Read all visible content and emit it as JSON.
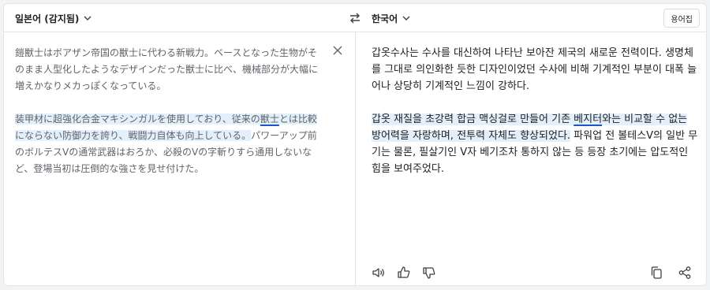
{
  "header": {
    "source_language": "일본어 (감지됨)",
    "target_language": "한국어",
    "glossary_label": "용어집"
  },
  "source": {
    "p1": "鎧獣士はボアザン帝国の獣士に代わる新戦力。ベースとなった生物がそのまま人型化したようなデザインだった獣士に比べ、機械部分が大幅に増えかなりメカっぽくなっている。",
    "p2_hl_a": "装甲材に超強化合金マキシンガルを使用しており、従来の",
    "p2_hl_word": "獣士",
    "p2_hl_b": "とは比較にならない防御力を誇り、戦闘力自体も向上している。",
    "p2_rest": "パワーアップ前のボルテスVの通常武器はおろか、必殺のVの字斬りすら通用しないなど、登場当初は圧倒的な強さを見せ付けた。"
  },
  "target": {
    "p1": "갑옷수사는 수사를 대신하여 나타난 보아잔 제국의 새로운 전력이다. 생명체를 그대로 의인화한 듯한 디자인이었던 수사에 비해 기계적인 부분이 대폭 늘어나 상당히 기계적인 느낌이 강하다.",
    "p2_hl_a": "갑옷 재질을 초강력 합금 맥싱걸로 만들어 기존 ",
    "p2_hl_word": "베지터",
    "p2_hl_b": "와는 비교할 수 없는 방어력을 자랑하며, 전투력 자체도 향상되었다.",
    "p2_rest": " 파워업 전 볼테스V의 일반 무기는 물론, 필살기인 V자 베기조차 통하지 않는 등 등장 초기에는 압도적인 힘을 보여주었다."
  },
  "colors": {
    "highlight": "#e3f0fb",
    "underline": "#1a56c8"
  },
  "icons": {
    "swap": "swap-arrows-icon",
    "clear": "close-icon",
    "speak": "speaker-icon",
    "like": "thumbs-up-icon",
    "dislike": "thumbs-down-icon",
    "copy": "copy-icon",
    "share": "share-icon"
  }
}
